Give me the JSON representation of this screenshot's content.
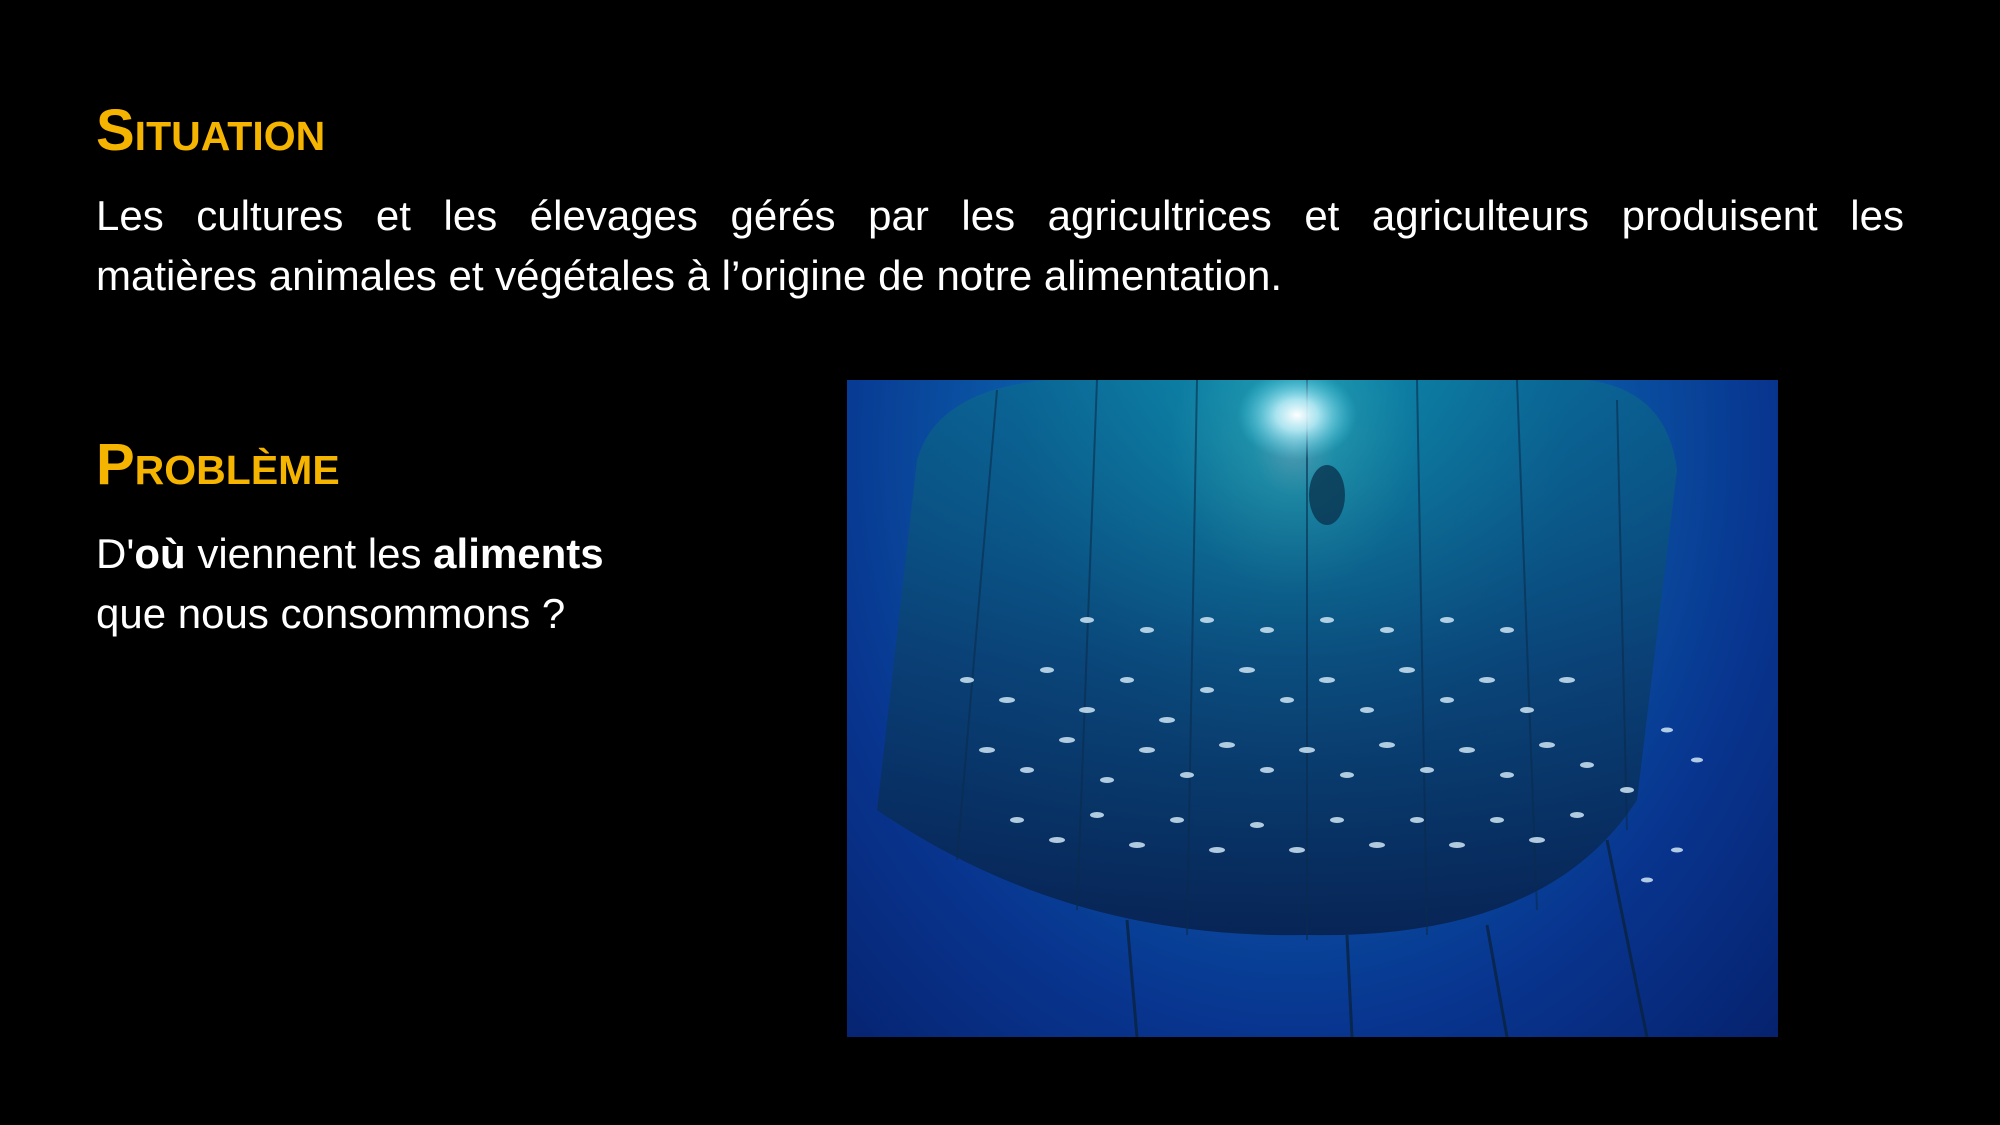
{
  "situation": {
    "heading": "Situation",
    "line1": "Les cultures et les élevages gérés par les agricultrices et agriculteurs produisent les",
    "line2": "matières animales et végétales à l’origine de notre alimentation."
  },
  "probleme": {
    "heading": "Problème",
    "q_part1": "D'",
    "q_bold1": "où",
    "q_part2": " viennent les ",
    "q_bold2": "aliments",
    "q_line2": "que nous consommons ?"
  },
  "colors": {
    "heading": "#f5b400",
    "text": "#ffffff",
    "background": "#000000"
  },
  "image": {
    "subject": "underwater fish farm net cage with school of fish"
  }
}
